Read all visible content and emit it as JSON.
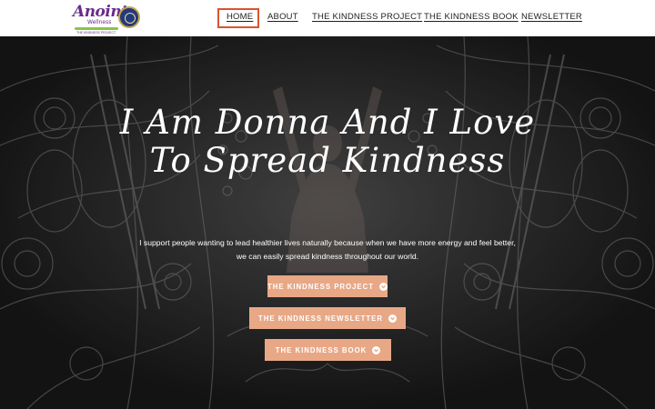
{
  "logo": {
    "script": "Anoint",
    "sub": "Wellness",
    "tag": "THE KINDNESS PROJECT"
  },
  "nav": {
    "items": [
      "HOME",
      "ABOUT",
      "THE KINDNESS PROJECT",
      "THE KINDNESS BOOK",
      "NEWSLETTER"
    ],
    "active": "HOME"
  },
  "hero": {
    "title": "I Am Donna And I Love To Spread Kindness",
    "text": "I support people wanting to lead healthier lives naturally because when we have more energy and feel better, we can easily spread kindness throughout our world.",
    "buttons": [
      "THE KINDNESS PROJECT",
      "THE KINDNESS NEWSLETTER",
      "THE KINDNESS BOOK"
    ]
  },
  "colors": {
    "accent_button": "#e8a886",
    "active_nav_border": "#d9542f",
    "logo_purple": "#6a2c8a"
  }
}
